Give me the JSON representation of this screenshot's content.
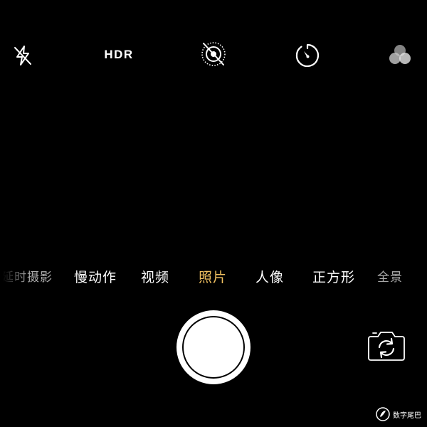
{
  "top_bar": {
    "flash_icon": "flash-off-icon",
    "hdr_label": "HDR",
    "live_photo_icon": "live-photo-off-icon",
    "timer_icon": "timer-icon",
    "filters_icon": "filters-icon"
  },
  "modes": [
    {
      "label": "延时摄影",
      "state": "faded"
    },
    {
      "label": "慢动作",
      "state": "normal"
    },
    {
      "label": "视频",
      "state": "normal"
    },
    {
      "label": "照片",
      "state": "active"
    },
    {
      "label": "人像",
      "state": "normal"
    },
    {
      "label": "正方形",
      "state": "normal"
    },
    {
      "label": "全景",
      "state": "faded"
    }
  ],
  "colors": {
    "background": "#000000",
    "active_mode": "#f0c060",
    "text": "#ffffff"
  },
  "controls": {
    "shutter_icon": "shutter-button",
    "flip_icon": "camera-flip-icon"
  },
  "watermark": {
    "text": "数字尾巴"
  }
}
